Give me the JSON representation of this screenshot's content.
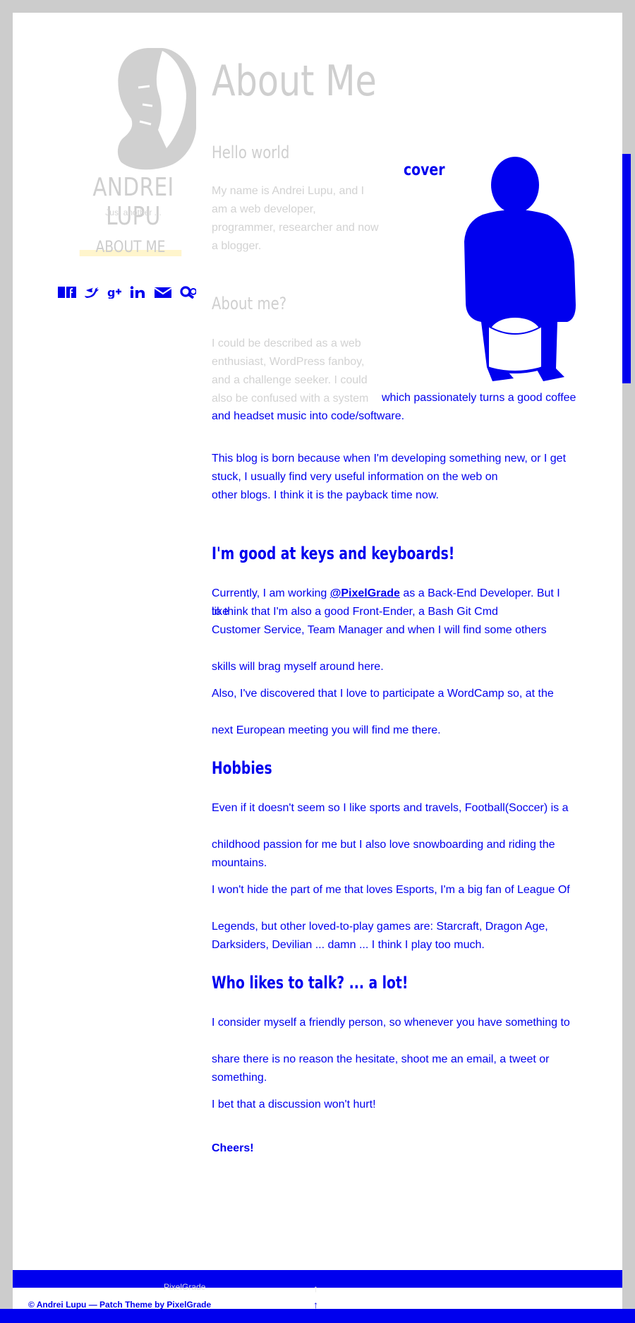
{
  "sidebar": {
    "site_name": "ANDREI LUPU",
    "tagline": "Just another ...",
    "nav": "ABOUT ME",
    "socials": [
      "facebook-icon",
      "twitter-icon",
      "google-plus-icon",
      "linkedin-icon",
      "email-icon",
      "search-icon"
    ]
  },
  "page": {
    "title": "About Me",
    "hello_heading": "Hello world",
    "intro": "My name is Andrei Lupu, and I am a web developer, programmer, researcher and now a blogger.",
    "cover_label": "cover",
    "about_heading": "About me?",
    "about_faint": "I could be described as a web enthusiast, WordPress fanboy, and a challenge seeker. I could also be confused with a system",
    "about_p1a": "which passionately turns a good coffee",
    "about_p1b": "and headset music into code/software.",
    "about_p2a": "This blog is born because when I'm developing something new, or I get",
    "about_p2b": "stuck, I usually find very useful information on the web on",
    "about_p2c": "other blogs. I think it is the payback time now.",
    "good_heading": "I'm good at keys and keyboards!",
    "good_p1_pre": "Currently, I am working ",
    "good_p1_link": "@PixelGrade",
    "good_p1_post": " as a Back-End Developer. But I like",
    "good_p1b": "to think that I'm also a good Front-Ender, a Bash Git Cmd",
    "good_p1c": "Customer Service, Team Manager and when I will find some others",
    "good_p1d": "skills will brag myself around here.",
    "good_p2a": "Also, I've discovered that I love to participate a WordCamp so, at the",
    "good_p2b": "next European meeting you will find me there.",
    "hobbies_heading": "Hobbies",
    "hob_p1a": "Even if it doesn't seem so I like sports and travels, Football(Soccer) is a",
    "hob_p1b": "childhood passion for me but I also love snowboarding and riding the",
    "hob_p1c": "mountains.",
    "hob_p2a": "I won't hide the part of me that loves Esports, I'm a big fan of League Of",
    "hob_p2b": "Legends, but other loved-to-play games are: Starcraft, Dragon Age,",
    "hob_p2c": "Darksiders, Devilian ... damn ... I think I play too much.",
    "talk_heading": "Who likes to talk? ... a lot!",
    "talk_p1a": "I consider myself a friendly person, so whenever you have something to",
    "talk_p1b": "share there is no reason the hesitate, shoot me an email, a tweet or",
    "talk_p1c": "something.",
    "talk_p2": "I bet that a discussion won't hurt!",
    "cheers": "Cheers!"
  },
  "footer": {
    "credit": "© Andrei Lupu — Patch Theme by PixelGrade",
    "pixelgrade": "PixelGrade",
    "totop": "↑"
  },
  "colors": {
    "link": "#0000ee",
    "faint": "#cfcfcf",
    "frame": "#cccccc"
  }
}
